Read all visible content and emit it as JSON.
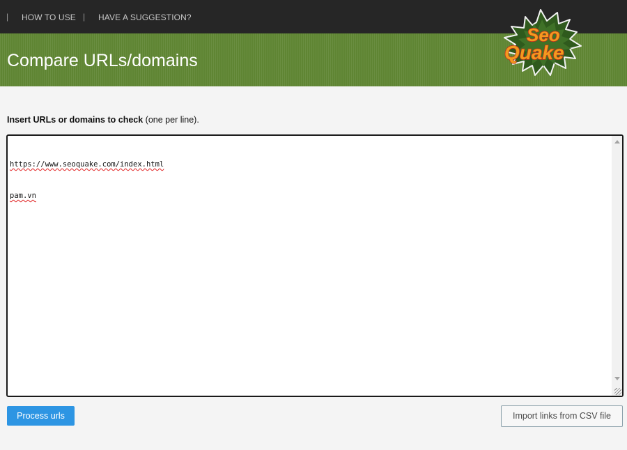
{
  "nav": {
    "separator": "|",
    "items": [
      {
        "label": "HOW TO USE"
      },
      {
        "label": "HAVE A SUGGESTION?"
      }
    ]
  },
  "header": {
    "title": "Compare URLs/domains"
  },
  "logo": {
    "line1": "Seo",
    "line2": "Quake"
  },
  "form": {
    "instruction_bold": "Insert URLs or domains to check",
    "instruction_normal": "(one per line).",
    "urls": [
      "https://www.seoquake.com/index.html",
      "pam.vn"
    ]
  },
  "buttons": {
    "process": "Process urls",
    "import": "Import links from CSV file"
  },
  "colors": {
    "nav_bg": "#262626",
    "banner_green": "#5f8533",
    "process_blue": "#2d95e3",
    "logo_orange": "#f39a1e",
    "logo_red": "#c0301c"
  }
}
